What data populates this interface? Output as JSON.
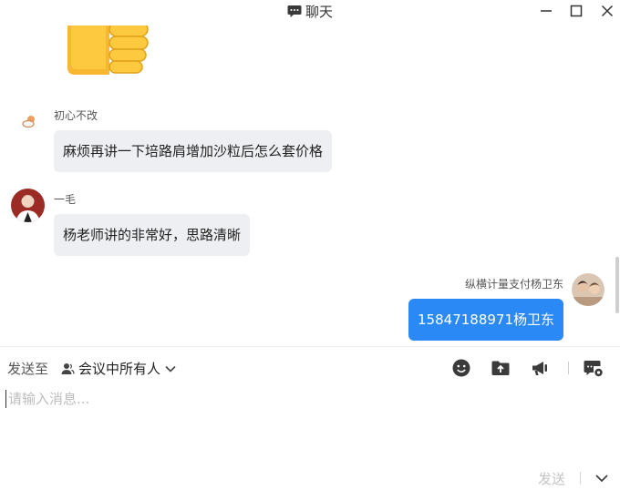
{
  "window": {
    "title": "聊天",
    "icons": {
      "title": "chat-bubble-icon",
      "minimize": "minimize-icon",
      "maximize": "maximize-icon",
      "close": "close-icon"
    }
  },
  "messages": [
    {
      "type": "sticker",
      "icon": "thumbs-up-sticker"
    },
    {
      "sender": "初心不改",
      "text": "麻烦再讲一下培路肩增加沙粒后怎么套价格",
      "mine": false
    },
    {
      "sender": "一毛",
      "text": "杨老师讲的非常好，思路清晰",
      "mine": false
    },
    {
      "sender": "纵横计量支付杨卫东",
      "text": "15847188971杨卫东",
      "mine": true
    }
  ],
  "compose": {
    "send_to_label": "发送至",
    "recipient": "会议中所有人",
    "placeholder": "请输入消息...",
    "send_label": "发送",
    "tools": [
      "emoji-icon",
      "folder-upload-icon",
      "announcement-icon",
      "chat-settings-icon"
    ]
  },
  "colors": {
    "my_bubble": "#2b89f6",
    "other_bubble": "#eeeff2"
  }
}
